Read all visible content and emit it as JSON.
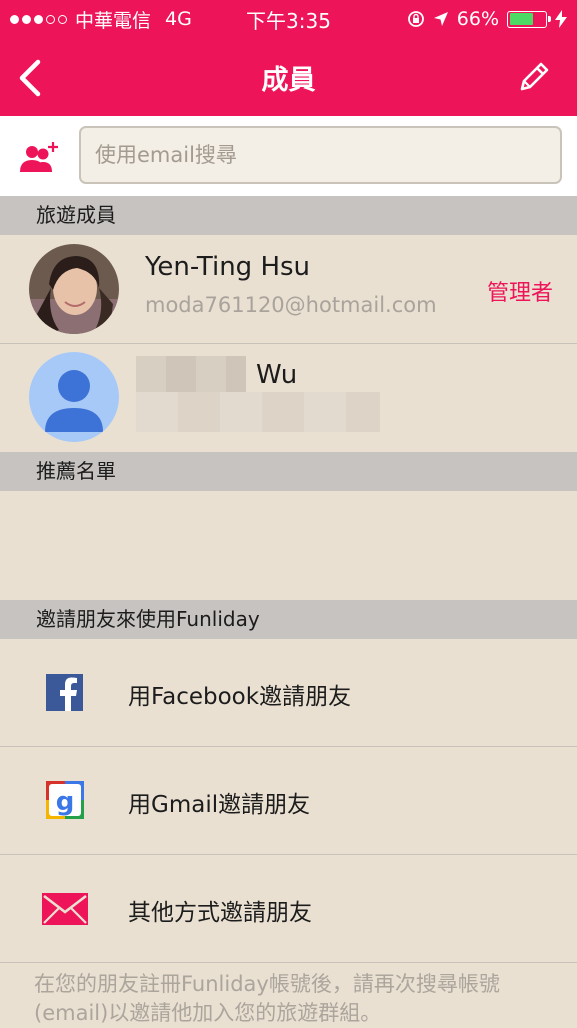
{
  "status_bar": {
    "carrier": "中華電信",
    "network": "4G",
    "time": "下午3:35",
    "battery": "66%"
  },
  "nav": {
    "title": "成員",
    "back_icon": "chevron-left-icon",
    "edit_icon": "pencil-icon"
  },
  "search": {
    "placeholder": "使用email搜尋",
    "value": ""
  },
  "sections": {
    "members_header": "旅遊成員",
    "recommend_header": "推薦名單",
    "invite_header": "邀請朋友來使用Funliday"
  },
  "members": [
    {
      "name": "Yen-Ting Hsu",
      "email": "moda761120@hotmail.com",
      "role": "管理者"
    },
    {
      "name": "Wu",
      "email": "",
      "role": ""
    }
  ],
  "invite": [
    {
      "label": "用Facebook邀請朋友",
      "icon": "facebook-icon"
    },
    {
      "label": "用Gmail邀請朋友",
      "icon": "google-icon"
    },
    {
      "label": "其他方式邀請朋友",
      "icon": "mail-icon"
    }
  ],
  "footer_note": "在您的朋友註冊Funliday帳號後，請再次搜尋帳號(email)以邀請他加入您的旅遊群組。",
  "colors": {
    "brand": "#ee1459",
    "background": "#e9e0d2",
    "section_header": "#c6c3c0"
  }
}
